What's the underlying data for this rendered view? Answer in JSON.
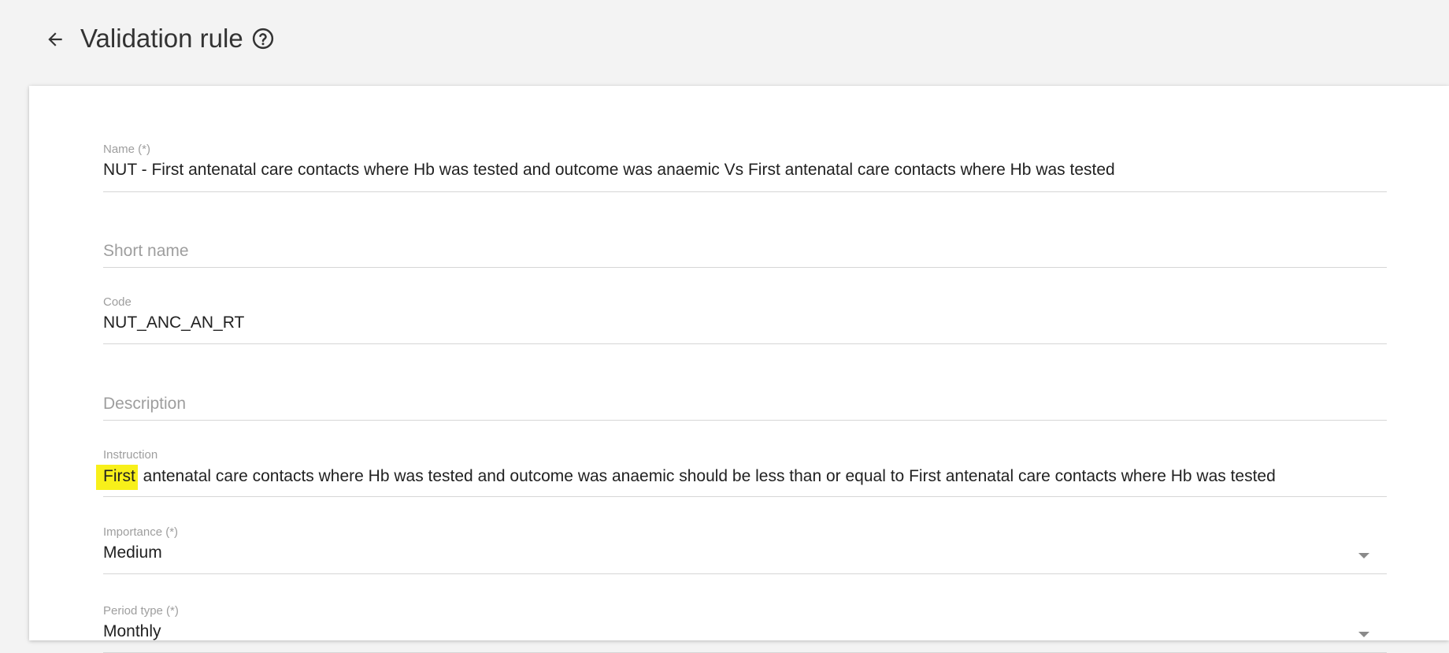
{
  "header": {
    "title": "Validation rule",
    "back_icon": "arrow-left-icon",
    "help_icon": "help-circle-icon"
  },
  "form": {
    "name": {
      "label": "Name (*)",
      "value": "NUT - First antenatal care contacts where Hb was tested and outcome was anaemic Vs First antenatal care contacts where Hb was tested"
    },
    "short_name": {
      "placeholder": "Short name",
      "value": ""
    },
    "code": {
      "label": "Code",
      "value": "NUT_ANC_AN_RT"
    },
    "description": {
      "placeholder": "Description",
      "value": ""
    },
    "instruction": {
      "label": "Instruction",
      "highlighted_word": "First",
      "value_rest": " antenatal care contacts where Hb was tested and outcome was anaemic should be less than or equal to First antenatal care contacts where Hb was tested",
      "highlight_color": "#f8f01a"
    },
    "importance": {
      "label": "Importance (*)",
      "value": "Medium"
    },
    "period_type": {
      "label": "Period type (*)",
      "value": "Monthly"
    }
  }
}
